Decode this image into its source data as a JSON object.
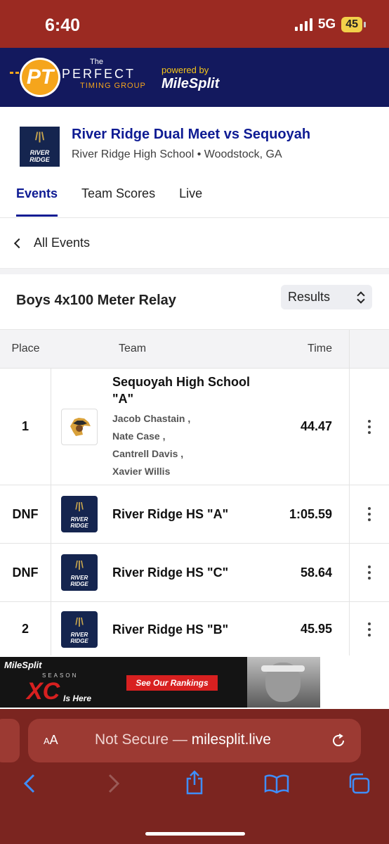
{
  "status_bar": {
    "time": "6:40",
    "network": "5G",
    "battery": "45"
  },
  "banner": {
    "logo_mark": "PT",
    "the": "The",
    "name": "PERFECT",
    "sub": "TIMING GROUP",
    "powered_by": "powered by",
    "brand": "MileSplit"
  },
  "meet": {
    "title": "River Ridge Dual Meet vs Sequoyah",
    "subtitle": "River Ridge High School • Woodstock, GA",
    "logo_text": "RIVER RIDGE",
    "tabs": [
      "Events",
      "Team Scores",
      "Live"
    ]
  },
  "nav": {
    "back_label": "All Events"
  },
  "event": {
    "title": "Boys 4x100 Meter Relay",
    "view_select": "Results"
  },
  "table": {
    "headers": {
      "place": "Place",
      "team": "Team",
      "time": "Time"
    },
    "rows": [
      {
        "place": "1",
        "team": "Sequoyah High School \"A\"",
        "athletes": [
          "Jacob Chastain ,",
          "Nate Case ,",
          "Cantrell Davis ,",
          "Xavier Willis"
        ],
        "time": "44.47",
        "logo": "sequoyah-logo"
      },
      {
        "place": "DNF",
        "team": "River Ridge HS \"A\"",
        "time": "1:05.59",
        "logo": "river-ridge-logo"
      },
      {
        "place": "DNF",
        "team": "River Ridge HS \"C\"",
        "time": "58.64",
        "logo": "river-ridge-logo"
      },
      {
        "place": "2",
        "team": "River Ridge HS \"B\"",
        "time": "45.95",
        "logo": "river-ridge-logo"
      }
    ]
  },
  "ad": {
    "brand": "MileSplit",
    "season": "SEASON",
    "xc": "XC",
    "is_here": "Is Here",
    "cta": "See Our Rankings"
  },
  "safari": {
    "aa": "AA",
    "not_secure": "Not Secure —",
    "domain": "milesplit.live"
  },
  "colors": {
    "status_bar": "#9b2a22",
    "banner": "#13195e",
    "accent": "#0e1b93",
    "safari": "#7b2520"
  }
}
